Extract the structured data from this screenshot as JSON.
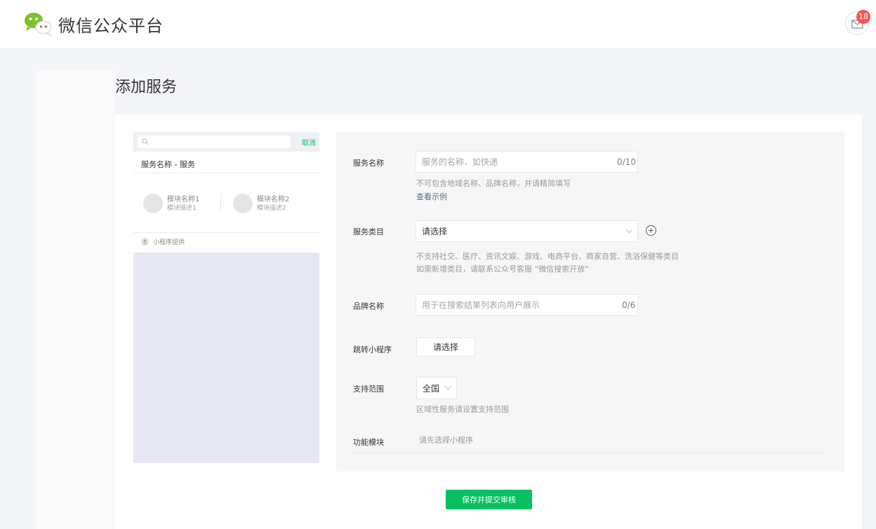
{
  "header": {
    "app_title": "微信公众平台",
    "logo_icon": "wechat-logo-icon",
    "mail_icon": "mail-icon",
    "mail_badge": "18"
  },
  "page": {
    "title": "添加服务"
  },
  "preview": {
    "search_icon": "search-icon",
    "cancel_label": "取消",
    "service_title": "服务名称 - 服务",
    "modules": [
      {
        "name": "模块名称1",
        "desc": "模块描述1"
      },
      {
        "name": "模块名称2",
        "desc": "模块描述2"
      }
    ],
    "provider_icon": "user-icon",
    "provider_label": "小程序提供"
  },
  "form": {
    "service_name": {
      "label": "服务名称",
      "placeholder": "服务的名称，如快递",
      "count": "0/10",
      "tip": "不可包含地域名称、品牌名称，并请精简填写",
      "link": "查看示例"
    },
    "service_category": {
      "label": "服务类目",
      "value": "请选择",
      "add_icon": "plus-circle-icon",
      "tip_line1": "不支持社交、医疗、资讯文娱、游戏、电商平台、商家自营、洗浴保健等类目",
      "tip_line2": "如需新增类目，请联系公众号客服 “微信搜索开放”"
    },
    "brand_name": {
      "label": "品牌名称",
      "placeholder": "用于在搜索结果列表向用户展示",
      "count": "0/6"
    },
    "mini_program": {
      "label": "跳转小程序",
      "button": "请选择"
    },
    "scope": {
      "label": "支持范围",
      "value": "全国",
      "tip": "区域性服务请设置支持范围"
    },
    "modules": {
      "label": "功能模块",
      "hint": "请先选择小程序"
    }
  },
  "actions": {
    "submit": "保存并提交审核"
  },
  "colors": {
    "accent_green": "#07c160",
    "link_blue": "#576b95",
    "badge_red": "#fa5151"
  }
}
